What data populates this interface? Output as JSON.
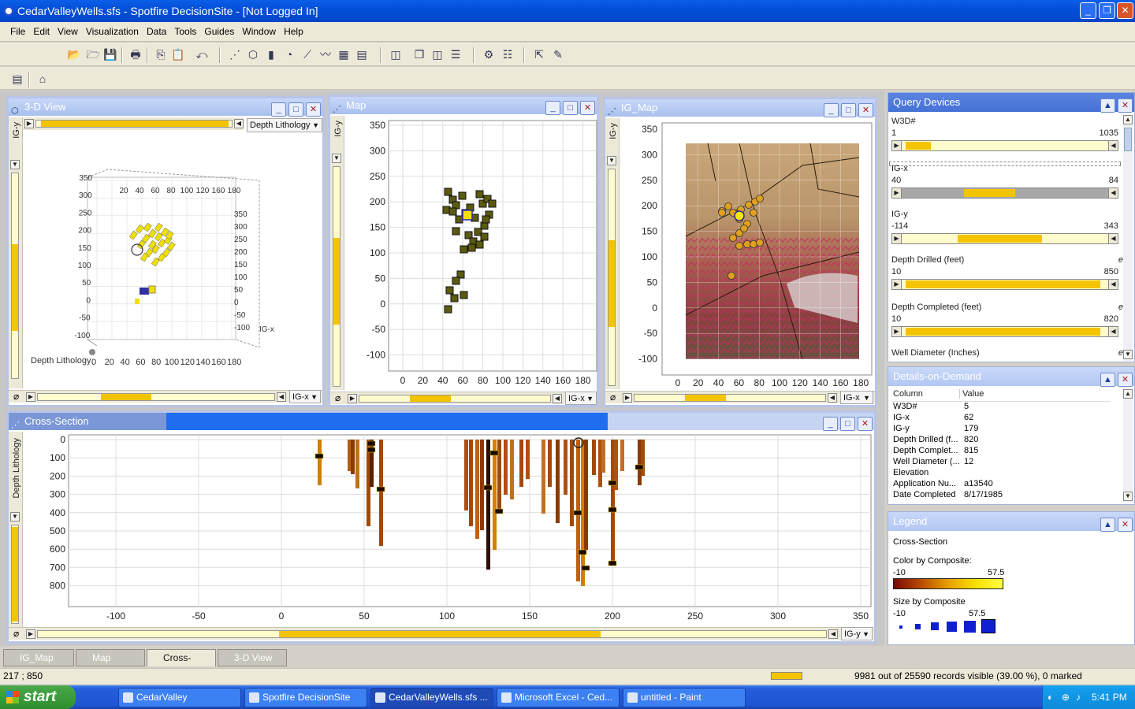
{
  "window": {
    "title": "CedarValleyWells.sfs - Spotfire DecisionSite - [Not Logged In]"
  },
  "menu": [
    "File",
    "Edit",
    "View",
    "Visualization",
    "Data",
    "Tools",
    "Guides",
    "Window",
    "Help"
  ],
  "panels": {
    "view3d": {
      "title": "3-D View",
      "y_axis": "IG-y",
      "dropdown": "Depth Lithology",
      "x_dropdown": "IG-x",
      "corner_label": "Depth Lithology",
      "ticks_left": [
        "350",
        "300",
        "250",
        "200",
        "150",
        "100",
        "50",
        "0",
        "-50",
        "-100"
      ],
      "ticks_right": [
        "350",
        "300",
        "250",
        "200",
        "150",
        "100",
        "50",
        "0",
        "-50",
        "-100"
      ],
      "ticks_bottom": [
        "0",
        "20",
        "40",
        "60",
        "80",
        "100",
        "120",
        "140",
        "160",
        "180"
      ],
      "ticks_top": [
        "20",
        "40",
        "60",
        "80",
        "100",
        "120",
        "160",
        "180"
      ],
      "axis_tag": "IG-x"
    },
    "map": {
      "title": "Map",
      "y_axis": "IG-y",
      "x_dropdown": "IG-x",
      "yticks": [
        "350",
        "300",
        "250",
        "200",
        "150",
        "100",
        "50",
        "0",
        "-50",
        "-100"
      ],
      "xticks": [
        "0",
        "20",
        "40",
        "60",
        "80",
        "100",
        "120",
        "140",
        "160",
        "180"
      ]
    },
    "igmap": {
      "title": "IG_Map",
      "y_axis": "IG-y",
      "x_dropdown": "IG-x",
      "yticks": [
        "350",
        "300",
        "250",
        "200",
        "150",
        "100",
        "50",
        "0",
        "-50",
        "-100"
      ],
      "xticks": [
        "0",
        "20",
        "40",
        "60",
        "80",
        "100",
        "120",
        "140",
        "160",
        "180"
      ]
    },
    "cross": {
      "title": "Cross-Section",
      "y_axis": "Depth Lithology",
      "x_dropdown": "IG-y",
      "yticks": [
        "0",
        "100",
        "200",
        "300",
        "400",
        "500",
        "600",
        "700",
        "800"
      ],
      "xticks": [
        "-100",
        "-50",
        "0",
        "50",
        "100",
        "150",
        "200",
        "250",
        "300",
        "350"
      ]
    }
  },
  "query_devices": {
    "title": "Query Devices",
    "items": [
      {
        "label": "W3D#",
        "min": "1",
        "max": "1035",
        "from": 0.02,
        "to": 0.14,
        "enabled": true
      },
      {
        "label": "IG-x",
        "min": "40",
        "max": "84",
        "from": 0.3,
        "to": 0.55,
        "enabled": false
      },
      {
        "label": "IG-y",
        "min": "-114",
        "max": "343",
        "from": 0.27,
        "to": 0.68,
        "enabled": true
      },
      {
        "label": "Depth Drilled (feet)",
        "min": "10",
        "max": "850",
        "from": 0.02,
        "to": 0.96,
        "enabled": true,
        "flag": "e"
      },
      {
        "label": "Depth Completed (feet)",
        "min": "10",
        "max": "820",
        "from": 0.02,
        "to": 0.96,
        "enabled": true,
        "flag": "e"
      }
    ],
    "last_label": "Well Diameter (Inches)",
    "last_flag": "e"
  },
  "details": {
    "title": "Details-on-Demand",
    "col_header": "Column",
    "val_header": "Value",
    "rows": [
      {
        "c": "W3D#",
        "v": "5"
      },
      {
        "c": "IG-x",
        "v": "62"
      },
      {
        "c": "IG-y",
        "v": "179"
      },
      {
        "c": "Depth Drilled (f...",
        "v": "820"
      },
      {
        "c": "Depth Complet...",
        "v": "815"
      },
      {
        "c": "Well Diameter (...",
        "v": "12"
      },
      {
        "c": "Elevation",
        "v": ""
      },
      {
        "c": "Application Nu...",
        "v": "a13540"
      },
      {
        "c": "Date Completed",
        "v": "8/17/1985"
      }
    ]
  },
  "legend": {
    "title": "Legend",
    "subtitle": "Cross-Section",
    "color_label": "Color by Composite:",
    "color_min": "-10",
    "color_max": "57.5",
    "size_label": "Size by Composite",
    "size_min": "-10",
    "size_max": "57.5"
  },
  "tabs": [
    "IG_Map",
    "Map",
    "Cross-Section",
    "3-D View"
  ],
  "status": {
    "coords": "217 ; 850",
    "records": "9981 out of 25590 records visible (39.00 %), 0 marked"
  },
  "taskbar": {
    "start": "start",
    "items": [
      "CedarValley",
      "Spotfire DecisionSite",
      "CedarValleyWells.sfs ...",
      "Microsoft Excel - Ced...",
      "untitled - Paint"
    ],
    "clock": "5:41 PM"
  },
  "colors": {
    "accent": "#f5c400",
    "title_blue": "#0450d8",
    "marker_dark": "#5a5a10"
  }
}
